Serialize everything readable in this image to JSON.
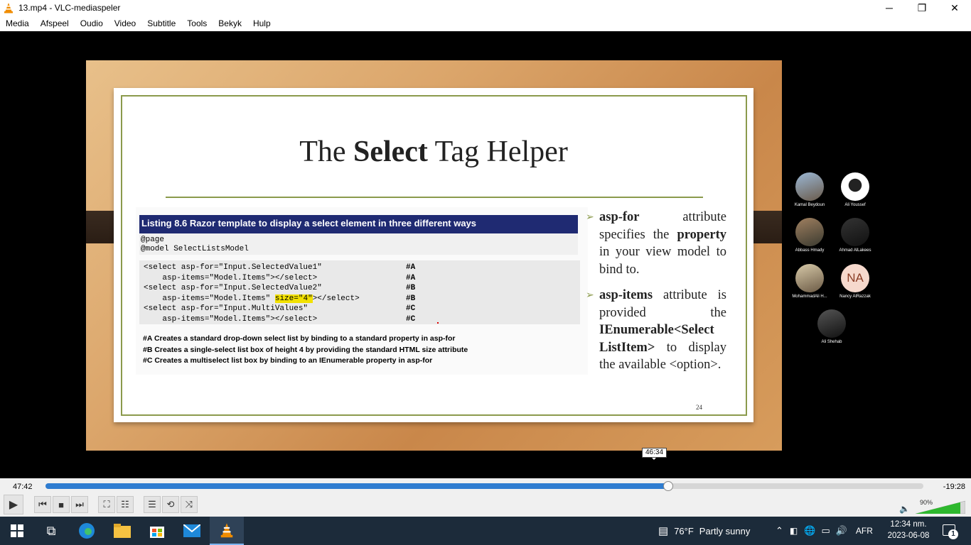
{
  "window": {
    "title": "13.mp4 - VLC-mediaspeler",
    "minimize": "─",
    "maximize": "❐",
    "close": "✕"
  },
  "menu": [
    "Media",
    "Afspeel",
    "Oudio",
    "Video",
    "Subtitle",
    "Tools",
    "Bekyk",
    "Hulp"
  ],
  "slide": {
    "title_pre": "The ",
    "title_bold": "Select",
    "title_post": " Tag Helper",
    "listing_title": "Listing 8.6 Razor template to display a select element in three different ways",
    "code_header": [
      "@page",
      "@model SelectListsModel"
    ],
    "code_lines": [
      {
        "text": "<select asp-for=\"Input.SelectedValue1\"",
        "tag": "#A"
      },
      {
        "text": "    asp-items=\"Model.Items\"></select>",
        "tag": "#A"
      },
      {
        "text": "<select asp-for=\"Input.SelectedValue2\"",
        "tag": "#B"
      },
      {
        "text_pre": "    asp-items=\"Model.Items\" ",
        "text_hl": "size=\"4\"",
        "text_post": "></select>",
        "tag": "#B"
      },
      {
        "text": "<select asp-for=\"Input.MultiValues\"",
        "tag": "#C"
      },
      {
        "text": "    asp-items=\"Model.Items\"></select>",
        "tag": "#C"
      }
    ],
    "notes": [
      "#A Creates a standard drop-down select list by binding to a standard property in asp-for",
      "#B Creates a single-select list box of height 4 by providing the standard HTML size attribute",
      "#C Creates a multiselect list box by binding to an IEnumerable property in asp-for"
    ],
    "bullet1": {
      "bold1": "asp-for",
      "t1": " attribute specifies the ",
      "bold2": "property",
      "t2": " in your view model to bind to."
    },
    "bullet2": {
      "bold1": "asp-items",
      "t1": " attribute is provided the ",
      "bold2": "IEnumerable<Select ListItem>",
      "t2": " to display the available <option>."
    },
    "page_number": "24"
  },
  "participants": [
    {
      "name": "Kamal Beydoun"
    },
    {
      "name": "Ali Youssef"
    },
    {
      "name": "Abbass Hmady"
    },
    {
      "name": "Ahmad AlLakees"
    },
    {
      "name": "MohammadAli H..."
    },
    {
      "name": "Nancy AlRazzak",
      "initials": "NA"
    },
    {
      "name": "Ali Shehab"
    }
  ],
  "player": {
    "elapsed": "47:42",
    "remaining": "-19:28",
    "hover_time": "46:34",
    "progress_fraction": 0.709,
    "volume": "90%",
    "accent": "#2e7cd0"
  },
  "taskbar": {
    "weather_temp": "76°F",
    "weather_text": "Partly sunny",
    "language": "AFR",
    "time": "12:34 nm.",
    "date": "2023-06-08",
    "notifications": "1"
  }
}
